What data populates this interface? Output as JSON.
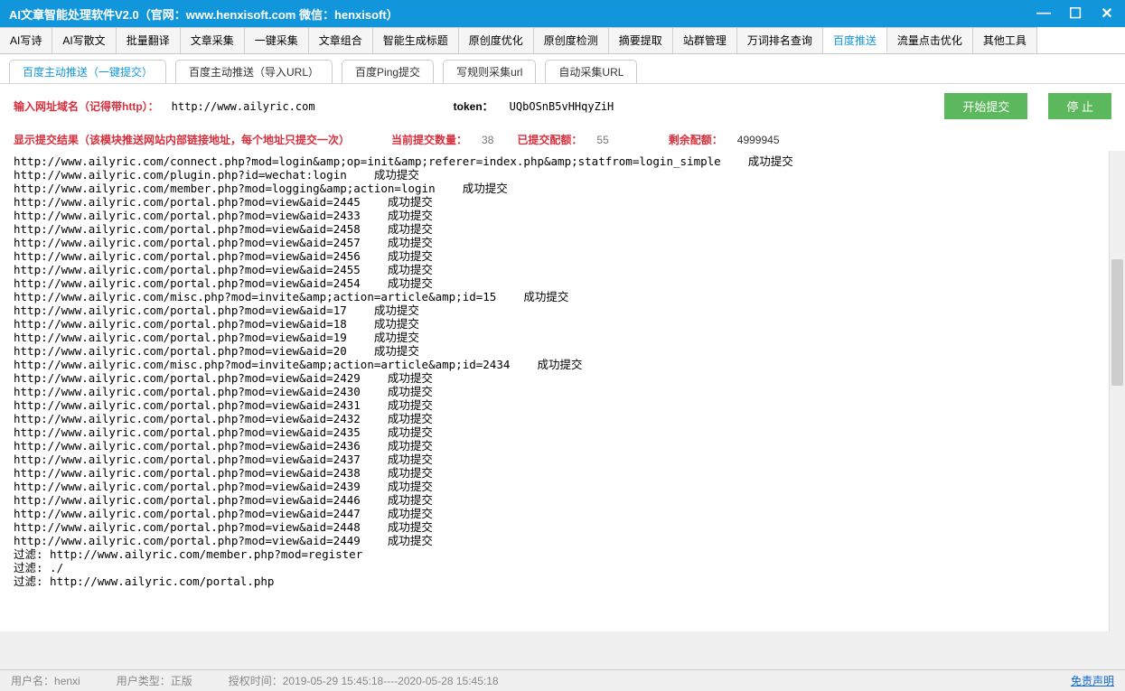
{
  "window": {
    "title": "AI文章智能处理软件V2.0（官网：www.henxisoft.com  微信：henxisoft）"
  },
  "main_tabs": [
    "AI写诗",
    "AI写散文",
    "批量翻译",
    "文章采集",
    "一键采集",
    "文章组合",
    "智能生成标题",
    "原创度优化",
    "原创度检测",
    "摘要提取",
    "站群管理",
    "万词排名查询",
    "百度推送",
    "流量点击优化",
    "其他工具"
  ],
  "main_tab_active": 12,
  "sub_tabs": [
    "百度主动推送（一键提交）",
    "百度主动推送（导入URL）",
    "百度Ping提交",
    "写规则采集url",
    "自动采集URL"
  ],
  "sub_tab_active": 0,
  "input": {
    "url_label": "输入网址域名（记得带http）：",
    "url_value": "http://www.ailyric.com",
    "token_label": "token：",
    "token_value": "UQbOSnB5vHHqyZiH",
    "start_btn": "开始提交",
    "stop_btn": "停 止"
  },
  "status": {
    "result_label": "显示提交结果（该模块推送网站内部链接地址，每个地址只提交一次）",
    "current_label": "当前提交数量：",
    "current_value": "38",
    "quota_used_label": "已提交配额：",
    "quota_used_value": "55",
    "quota_remain_label": "剩余配额：",
    "quota_remain_value": "4999945"
  },
  "log_lines": [
    "http://www.ailyric.com/connect.php?mod=login&amp;op=init&amp;referer=index.php&amp;statfrom=login_simple    成功提交",
    "http://www.ailyric.com/plugin.php?id=wechat:login    成功提交",
    "http://www.ailyric.com/member.php?mod=logging&amp;action=login    成功提交",
    "http://www.ailyric.com/portal.php?mod=view&aid=2445    成功提交",
    "http://www.ailyric.com/portal.php?mod=view&aid=2433    成功提交",
    "http://www.ailyric.com/portal.php?mod=view&aid=2458    成功提交",
    "http://www.ailyric.com/portal.php?mod=view&aid=2457    成功提交",
    "http://www.ailyric.com/portal.php?mod=view&aid=2456    成功提交",
    "http://www.ailyric.com/portal.php?mod=view&aid=2455    成功提交",
    "http://www.ailyric.com/portal.php?mod=view&aid=2454    成功提交",
    "http://www.ailyric.com/misc.php?mod=invite&amp;action=article&amp;id=15    成功提交",
    "http://www.ailyric.com/portal.php?mod=view&aid=17    成功提交",
    "http://www.ailyric.com/portal.php?mod=view&aid=18    成功提交",
    "http://www.ailyric.com/portal.php?mod=view&aid=19    成功提交",
    "http://www.ailyric.com/portal.php?mod=view&aid=20    成功提交",
    "http://www.ailyric.com/misc.php?mod=invite&amp;action=article&amp;id=2434    成功提交",
    "http://www.ailyric.com/portal.php?mod=view&aid=2429    成功提交",
    "http://www.ailyric.com/portal.php?mod=view&aid=2430    成功提交",
    "http://www.ailyric.com/portal.php?mod=view&aid=2431    成功提交",
    "http://www.ailyric.com/portal.php?mod=view&aid=2432    成功提交",
    "http://www.ailyric.com/portal.php?mod=view&aid=2435    成功提交",
    "http://www.ailyric.com/portal.php?mod=view&aid=2436    成功提交",
    "http://www.ailyric.com/portal.php?mod=view&aid=2437    成功提交",
    "http://www.ailyric.com/portal.php?mod=view&aid=2438    成功提交",
    "http://www.ailyric.com/portal.php?mod=view&aid=2439    成功提交",
    "http://www.ailyric.com/portal.php?mod=view&aid=2446    成功提交",
    "http://www.ailyric.com/portal.php?mod=view&aid=2447    成功提交",
    "http://www.ailyric.com/portal.php?mod=view&aid=2448    成功提交",
    "http://www.ailyric.com/portal.php?mod=view&aid=2449    成功提交",
    "",
    "过滤: http://www.ailyric.com/member.php?mod=register",
    "过滤: ./",
    "过滤: http://www.ailyric.com/portal.php"
  ],
  "footer": {
    "user_label": "用户名：",
    "user_value": "henxi",
    "type_label": "用户类型：",
    "type_value": "正版",
    "auth_label": "授权时间：",
    "auth_value": "2019-05-29 15:45:18----2020-05-28 15:45:18",
    "disclaimer": "免责声明"
  }
}
